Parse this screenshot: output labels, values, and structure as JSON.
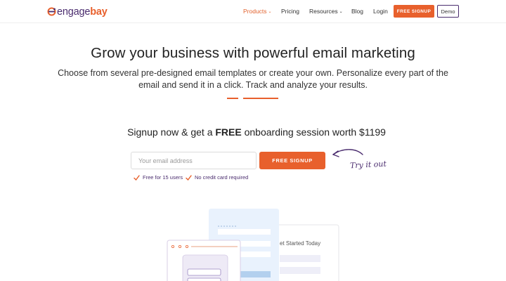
{
  "logo": {
    "text_a": "engage",
    "text_b": "bay",
    "icon": "engagebay-logo-icon"
  },
  "nav": {
    "items": [
      {
        "label": "Products",
        "caret": "⌄"
      },
      {
        "label": "Pricing"
      },
      {
        "label": "Resources",
        "caret": "⌄"
      },
      {
        "label": "Blog"
      },
      {
        "label": "Login"
      }
    ],
    "signup_label": "FREE SIGNUP",
    "demo_label": "Demo"
  },
  "hero": {
    "title": "Grow your business with powerful email marketing",
    "subtitle": "Choose from several pre-designed email templates or create your own. Personalize every part of the email and send it in a click. Track and analyze your results."
  },
  "offer": {
    "prefix": "Signup now & get a ",
    "highlight": "FREE",
    "suffix": " onboarding session worth $1199"
  },
  "signup_form": {
    "email_placeholder": "Your email address",
    "button_label": "FREE SIGNUP",
    "try_it": "Try it out"
  },
  "checks": [
    {
      "label": "Free for 15 users",
      "icon": "check-icon"
    },
    {
      "label": "No credit card required",
      "icon": "check-icon"
    }
  ],
  "illustration": {
    "card_text": "et Started Today"
  },
  "colors": {
    "accent": "#e8602c",
    "brand_purple": "#4a2c6e"
  }
}
